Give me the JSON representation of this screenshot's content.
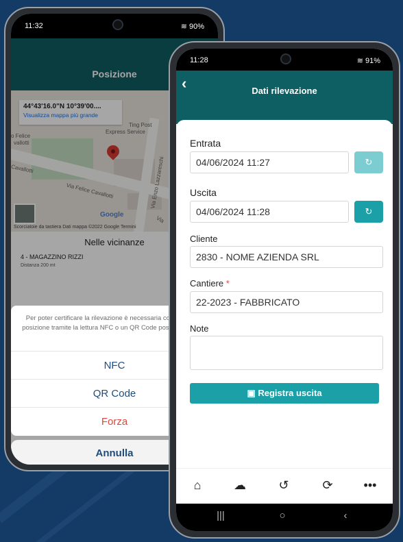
{
  "phone_left": {
    "status": {
      "time": "11:32",
      "battery": "90%"
    },
    "header": {
      "title": "Posizione"
    },
    "map": {
      "coordinates": "44°43'16.0\"N 10°39'00....",
      "view_larger_link": "Visualizza mappa più grande",
      "labels": [
        "Ting Post",
        "Express Service",
        "o Felice",
        "vallotti",
        "Cavallotti",
        "Via Felice Cavallotti",
        "Via Enzo Lazzareschi",
        "Via"
      ],
      "google_logo": "Google",
      "footer": "Scorciatoie da tastiera   Dati mappa ©2022 Google   Termini"
    },
    "nearby": {
      "title": "Nelle vicinanze",
      "item_name": "4 - MAGAZZINO RIZZI",
      "item_distance": "Distanza 200 mt"
    },
    "sheet": {
      "message": "Per poter certificare la rilevazione è necessaria conferma della posizione tramite la lettura NFC o un QR Code posto sul cantiere",
      "options": [
        "NFC",
        "QR Code",
        "Forza"
      ],
      "cancel": "Annulla"
    }
  },
  "phone_right": {
    "status": {
      "time": "11:28",
      "battery": "91%"
    },
    "header": {
      "title": "Dati rilevazione"
    },
    "form": {
      "entrata_label": "Entrata",
      "entrata_value": "04/06/2024  11:27",
      "uscita_label": "Uscita",
      "uscita_value": "04/06/2024  11:28",
      "cliente_label": "Cliente",
      "cliente_value": "2830 -   NOME AZIENDA  SRL",
      "cantiere_label": "Cantiere",
      "cantiere_required": "*",
      "cantiere_value": "22-2023 - FABBRICATO",
      "note_label": "Note",
      "note_value": "",
      "submit_label": "Registra uscita"
    },
    "tabbar": [
      "home-icon",
      "cloud-upload-icon",
      "history-icon",
      "sync-icon",
      "more-icon"
    ]
  },
  "colors": {
    "teal_dark": "#0e5f63",
    "teal_button": "#1aa0a6",
    "background": "#143a66",
    "forza": "#e0463b",
    "sheet_text": "#1f4c7c"
  }
}
